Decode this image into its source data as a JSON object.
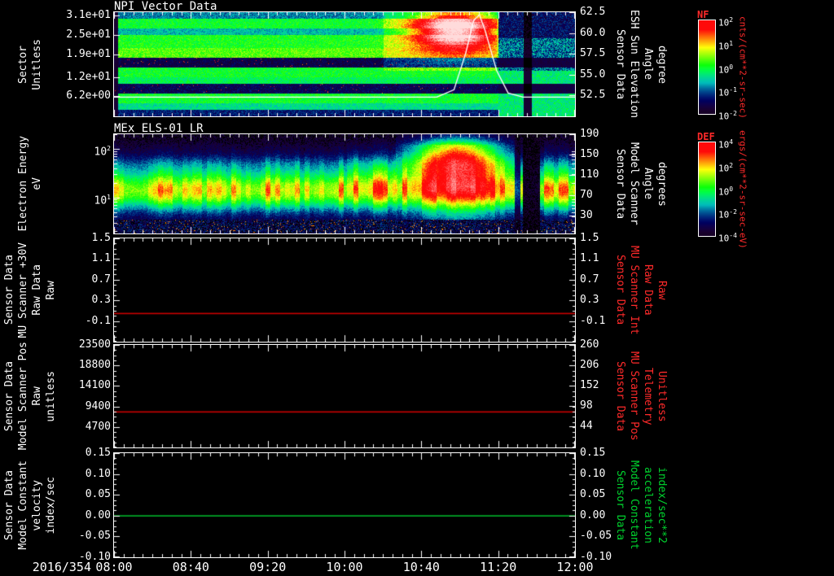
{
  "figure": {
    "background": "#000000",
    "date_label": "2016/354",
    "time_ticks": [
      "08:00",
      "08:40",
      "09:20",
      "10:00",
      "10:40",
      "11:20",
      "12:00"
    ],
    "time_range_hours": [
      0,
      4
    ]
  },
  "chart_data": [
    {
      "id": "npi",
      "type": "heatmap",
      "style": "npi",
      "title": "NPI Vector Data",
      "colormap": "rainbow",
      "ylabel_lines": [
        "Sector",
        "Unitless"
      ],
      "yscale": "linear",
      "yrange": [
        0,
        32
      ],
      "ytick_labels": [
        "3.1e+01",
        "2.5e+01",
        "1.9e+01",
        "1.2e+01",
        "6.2e+00"
      ],
      "ytick_values": [
        31,
        25,
        19,
        12,
        6.2
      ],
      "right_axis": {
        "label_lines": [
          "Sensor Data",
          "ESH Sun Elevation",
          "Angle",
          "degree"
        ],
        "color": "#ffffff",
        "range": [
          50,
          62.5
        ],
        "tick_labels": [
          "62.5",
          "60.0",
          "57.5",
          "55.0",
          "52.5"
        ],
        "tick_values": [
          62.5,
          60.0,
          57.5,
          55.0,
          52.5
        ]
      },
      "overlay_line": {
        "name": "sun-elevation-angle",
        "color": "#ffffff",
        "points_hours_value": [
          [
            0,
            52.3
          ],
          [
            2.8,
            52.3
          ],
          [
            2.95,
            53.2
          ],
          [
            3.05,
            57.5
          ],
          [
            3.12,
            61.5
          ],
          [
            3.17,
            62.2
          ],
          [
            3.22,
            60.3
          ],
          [
            3.32,
            55.5
          ],
          [
            3.42,
            52.8
          ],
          [
            3.55,
            52.3
          ],
          [
            4,
            52.3
          ]
        ]
      },
      "description": "Neutral particle counts per sector; blue/cyan banded, dark bands near sectors 15-16 and 22-24, bright patch 10:30-11:05, dim purple after 11:20"
    },
    {
      "id": "els",
      "type": "heatmap",
      "style": "els",
      "title": "MEx ELS-01 LR",
      "colormap": "rainbow",
      "ylabel_lines": [
        "Electron Energy",
        "eV"
      ],
      "yscale": "log",
      "yrange": [
        1.8,
        200
      ],
      "ytick_labels": [
        "10^2",
        "10^1"
      ],
      "ytick_values": [
        100,
        10
      ],
      "right_axis": {
        "label_lines": [
          "Sensor Data",
          "Model Scanner",
          "Angle",
          "degrees"
        ],
        "color": "#ffffff",
        "range": [
          -5,
          190
        ],
        "tick_labels": [
          "190",
          "150",
          "110",
          "70",
          "30"
        ],
        "tick_values": [
          190,
          150,
          110,
          70,
          30
        ]
      },
      "description": "Electron differential energy flux; green band 5-30 eV, intense red enhancement 10:40-11:10, dark data-gap stripes near 11:25-11:35"
    },
    {
      "id": "mu-scanner-raw",
      "type": "line",
      "title": "",
      "ylabel_lines": [
        "Sensor Data",
        "MU Scanner +30V",
        "Raw Data",
        "Raw"
      ],
      "yscale": "linear",
      "yrange": [
        -0.5,
        1.5
      ],
      "ytick_labels": [
        "1.5",
        "1.1",
        "0.7",
        "0.3",
        "-0.1"
      ],
      "ytick_values": [
        1.5,
        1.1,
        0.7,
        0.3,
        -0.1
      ],
      "right_axis": {
        "label_lines": [
          "Sensor Data",
          "MU Scanner Int",
          "Raw Data",
          "Raw"
        ],
        "color": "#ff2a2a",
        "range": [
          -0.5,
          1.5
        ],
        "tick_labels": [
          "1.5",
          "1.1",
          "0.7",
          "0.3",
          "-0.1"
        ],
        "tick_values": [
          1.5,
          1.1,
          0.7,
          0.3,
          -0.1
        ]
      },
      "series": [
        {
          "name": "mu-scanner-raw",
          "color": "#cc0000",
          "constant_value": 0.05
        }
      ]
    },
    {
      "id": "model-scanner-pos",
      "type": "line",
      "title": "",
      "ylabel_lines": [
        "Sensor Data",
        "Model Scanner Pos",
        "Raw",
        "unitless"
      ],
      "yscale": "linear",
      "yrange": [
        0,
        23500
      ],
      "ytick_labels": [
        "23500",
        "18800",
        "14100",
        "9400",
        "4700"
      ],
      "ytick_values": [
        23500,
        18800,
        14100,
        9400,
        4700
      ],
      "right_axis": {
        "label_lines": [
          "Sensor Data",
          "MU Scanner Pos",
          "Telemetry",
          "Unitless"
        ],
        "color": "#ff2a2a",
        "range": [
          -12,
          260
        ],
        "tick_labels": [
          "260",
          "206",
          "152",
          "98",
          "44"
        ],
        "tick_values": [
          260,
          206,
          152,
          98,
          44
        ]
      },
      "series": [
        {
          "name": "model-scanner-pos",
          "color": "#cc0000",
          "constant_value": 8200
        }
      ]
    },
    {
      "id": "model-constant-velocity",
      "type": "line",
      "title": "",
      "ylabel_lines": [
        "Sensor Data",
        "Model Constant",
        "velocity",
        "index/sec"
      ],
      "yscale": "linear",
      "yrange": [
        -0.1,
        0.15
      ],
      "ytick_labels": [
        "0.15",
        "0.10",
        "0.05",
        "0.00",
        "-0.05",
        "-0.10"
      ],
      "ytick_values": [
        0.15,
        0.1,
        0.05,
        0.0,
        -0.05,
        -0.1
      ],
      "right_axis": {
        "label_lines": [
          "Sensor Data",
          "Model Constant",
          "acceleration",
          "index/sec**2"
        ],
        "color": "#00d22e",
        "range": [
          -0.1,
          0.15
        ],
        "tick_labels": [
          "0.15",
          "0.10",
          "0.05",
          "0.00",
          "-0.05",
          "-0.10"
        ],
        "tick_values": [
          0.15,
          0.1,
          0.05,
          0.0,
          -0.05,
          -0.1
        ]
      },
      "series": [
        {
          "name": "model-constant-velocity",
          "color": "#00b428",
          "constant_value": 0.0
        }
      ]
    }
  ],
  "colorbars": [
    {
      "label": "NF",
      "label_color": "#ff2a2a",
      "tick_labels": [
        "10^2",
        "10^1",
        "10^0",
        "10^-1",
        "10^-2"
      ],
      "unit": "cnts/(cm**2-sr-sec)",
      "unit_color": "#ff2a2a",
      "attached_panel": "npi"
    },
    {
      "label": "DEF",
      "label_color": "#ff2a2a",
      "tick_labels": [
        "10^4",
        "10^2",
        "10^0",
        "10^-2",
        "10^-4"
      ],
      "unit": "ergs/(cm**2-sr-sec-eV)",
      "unit_color": "#ff2a2a",
      "attached_panel": "els"
    }
  ]
}
